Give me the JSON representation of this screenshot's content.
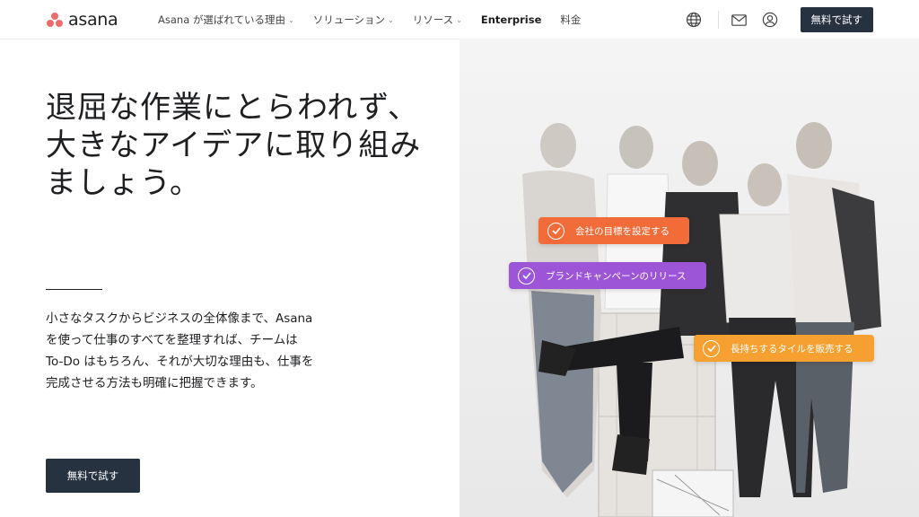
{
  "brand": {
    "name": "asana",
    "logo_color": "#f06a6a"
  },
  "nav": {
    "items": [
      {
        "label": "Asana が選ばれている理由",
        "has_dropdown": true
      },
      {
        "label": "ソリューション",
        "has_dropdown": true
      },
      {
        "label": "リソース",
        "has_dropdown": true
      },
      {
        "label": "Enterprise",
        "has_dropdown": false
      },
      {
        "label": "料金",
        "has_dropdown": false
      }
    ],
    "icons": [
      "globe-icon",
      "mail-icon",
      "user-icon"
    ],
    "cta_label": "無料で試す"
  },
  "hero": {
    "title": "退屈な作業にとらわれず、大きなアイデアに取り組みましょう。",
    "description": "小さなタスクからビジネスの全体像まで、Asana を使って仕事のすべてを整理すれば、チームは To-Do はもちろん、それが大切な理由も、仕事を完成させる方法も明確に把握できます。",
    "cta_label": "無料で試す"
  },
  "tags": [
    {
      "label": "会社の目標を設定する",
      "color": "#f26c3a"
    },
    {
      "label": "ブランドキャンペーンのリリース",
      "color": "#9b55d6"
    },
    {
      "label": "長持ちするタイルを販売する",
      "color": "#f5a030"
    }
  ],
  "colors": {
    "dark_button": "#273240",
    "text": "#1e1f21"
  }
}
